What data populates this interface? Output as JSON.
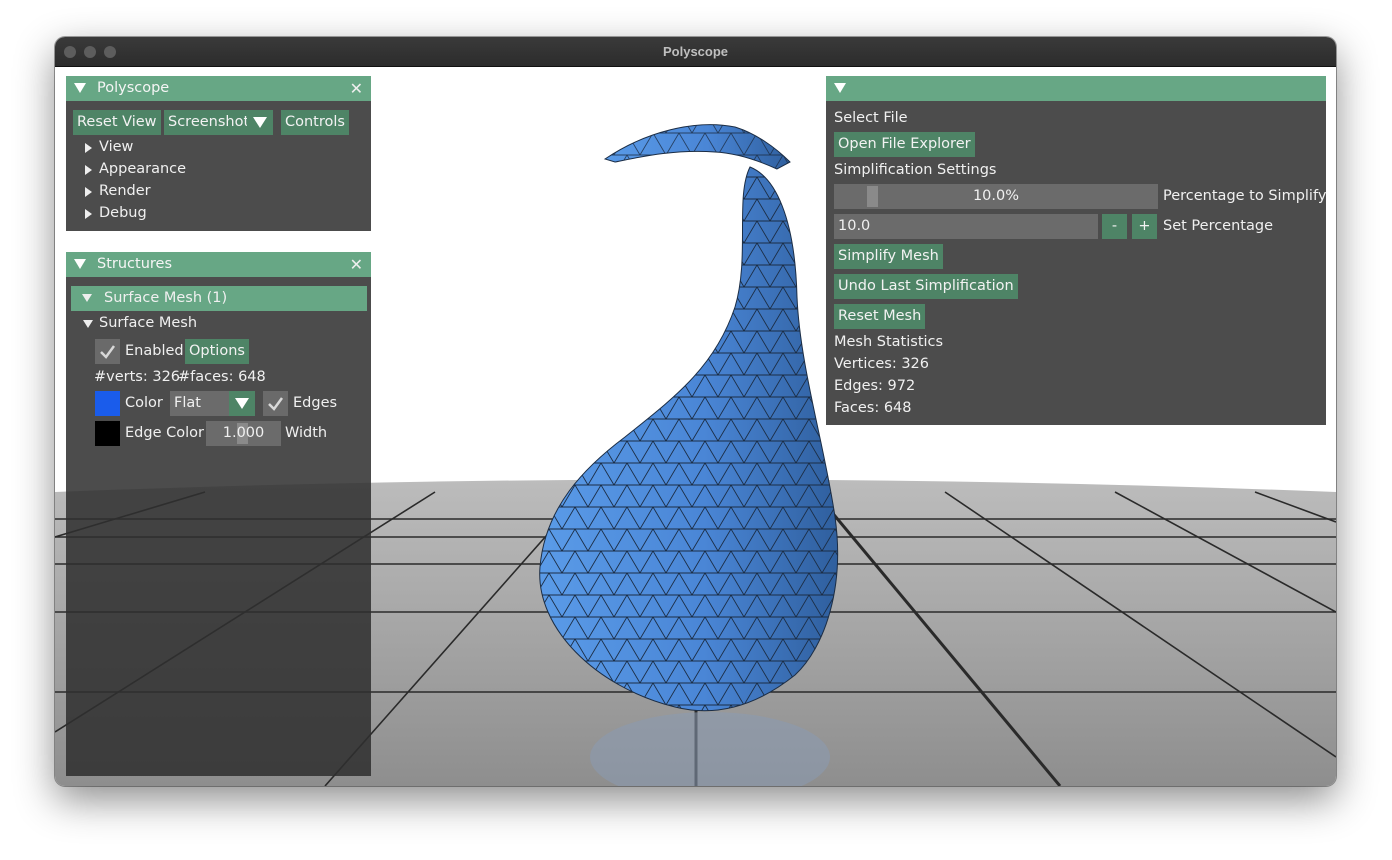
{
  "window": {
    "title": "Polyscope"
  },
  "polyscope_panel": {
    "title": "Polyscope",
    "buttons": {
      "reset_view": "Reset View",
      "screenshot": "Screenshot",
      "controls": "Controls"
    },
    "tree": [
      "View",
      "Appearance",
      "Render",
      "Debug"
    ]
  },
  "structures_panel": {
    "title": "Structures",
    "group_header": "Surface Mesh (1)",
    "mesh_name": "Surface Mesh",
    "enabled_label": "Enabled",
    "enabled": true,
    "options_label": "Options",
    "verts_label": "#verts: 326",
    "faces_label": "#faces: 648",
    "color_label": "Color",
    "color_value": "#1a5ceb",
    "shade_mode": "Flat",
    "edges_label": "Edges",
    "edges_enabled": true,
    "edge_color_label": "Edge Color",
    "edge_color_value": "#000000",
    "width_value": "1.000",
    "width_label": "Width"
  },
  "simplify_panel": {
    "select_file_label": "Select File",
    "open_file_button": "Open File Explorer",
    "settings_label": "Simplification Settings",
    "slider_value_text": "10.0%",
    "slider_fraction": 0.1,
    "slider_label": "Percentage to Simplify",
    "input_value": "10.0",
    "minus_label": "-",
    "plus_label": "+",
    "set_label": "Set Percentage",
    "simplify_button": "Simplify Mesh",
    "undo_button": "Undo Last Simplification",
    "reset_button": "Reset Mesh",
    "stats_title": "Mesh Statistics",
    "vertices": "Vertices: 326",
    "edges": "Edges: 972",
    "faces": "Faces: 648"
  },
  "colors": {
    "accent": "#67a785",
    "button": "#4e8466",
    "mesh": "#4a86d6"
  }
}
